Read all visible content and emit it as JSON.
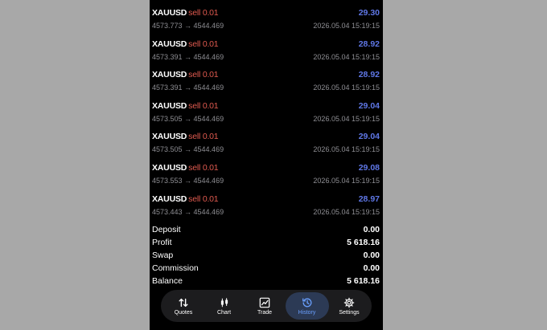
{
  "deals": [
    {
      "symbol": "XAUUSD",
      "side": "sell 0.01",
      "profit": "29.30",
      "prices": "4573.773 → 4544.469",
      "time": "2026.05.04 15:19:15"
    },
    {
      "symbol": "XAUUSD",
      "side": "sell 0.01",
      "profit": "28.92",
      "prices": "4573.391 → 4544.469",
      "time": "2026.05.04 15:19:15"
    },
    {
      "symbol": "XAUUSD",
      "side": "sell 0.01",
      "profit": "28.92",
      "prices": "4573.391 → 4544.469",
      "time": "2026.05.04 15:19:15"
    },
    {
      "symbol": "XAUUSD",
      "side": "sell 0.01",
      "profit": "29.04",
      "prices": "4573.505 → 4544.469",
      "time": "2026.05.04 15:19:15"
    },
    {
      "symbol": "XAUUSD",
      "side": "sell 0.01",
      "profit": "29.04",
      "prices": "4573.505 → 4544.469",
      "time": "2026.05.04 15:19:15"
    },
    {
      "symbol": "XAUUSD",
      "side": "sell 0.01",
      "profit": "29.08",
      "prices": "4573.553 → 4544.469",
      "time": "2026.05.04 15:19:15"
    },
    {
      "symbol": "XAUUSD",
      "side": "sell 0.01",
      "profit": "28.97",
      "prices": "4573.443 → 4544.469",
      "time": "2026.05.04 15:19:15"
    }
  ],
  "summary": [
    {
      "label": "Deposit",
      "value": "0.00"
    },
    {
      "label": "Profit",
      "value": "5 618.16"
    },
    {
      "label": "Swap",
      "value": "0.00"
    },
    {
      "label": "Commission",
      "value": "0.00"
    },
    {
      "label": "Balance",
      "value": "5 618.16"
    }
  ],
  "tabs": [
    {
      "label": "Quotes",
      "icon": "quotes-arrows-icon"
    },
    {
      "label": "Chart",
      "icon": "candlestick-icon"
    },
    {
      "label": "Trade",
      "icon": "trend-chart-icon"
    },
    {
      "label": "History",
      "icon": "clock-history-icon",
      "active": true
    },
    {
      "label": "Settings",
      "icon": "gear-icon"
    }
  ],
  "colors": {
    "background": "#000000",
    "sell": "#e05a4f",
    "profit": "#5f77e6",
    "secondary_text": "#8e8e93",
    "active_tab": "#6aa0ff"
  }
}
